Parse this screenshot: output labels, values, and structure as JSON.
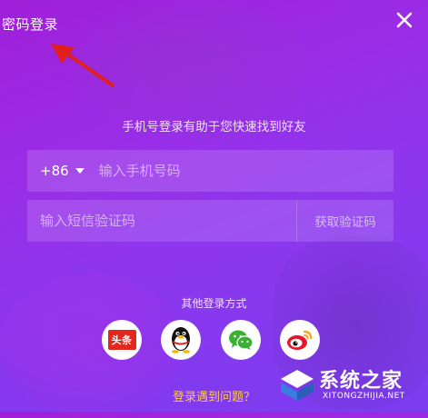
{
  "topbar": {
    "title": "密码登录"
  },
  "login": {
    "subtitle": "手机号登录有助于您快速找到好友",
    "country_code": "+86",
    "phone_placeholder": "输入手机号码",
    "code_placeholder": "输入短信验证码",
    "get_code_label": "获取验证码"
  },
  "other_login": {
    "label": "其他登录方式",
    "providers": [
      {
        "name": "toutiao",
        "badge": "头条",
        "icon": "toutiao-icon"
      },
      {
        "name": "qq",
        "icon": "qq-penguin-icon"
      },
      {
        "name": "wechat",
        "icon": "wechat-icon"
      },
      {
        "name": "weibo",
        "icon": "weibo-icon"
      }
    ]
  },
  "help": {
    "trouble_label": "登录遇到问题？"
  },
  "watermark": {
    "title": "系统之家",
    "subtitle": "XITONGZHIJIA.NET"
  },
  "colors": {
    "background_start": "#a01fd8",
    "background_end": "#7a3df0",
    "link": "#ffc94a",
    "arrow": "#e0201c",
    "toutiao_red": "#e5261c",
    "wechat_green": "#3cb034",
    "weibo_red": "#e6162d"
  }
}
